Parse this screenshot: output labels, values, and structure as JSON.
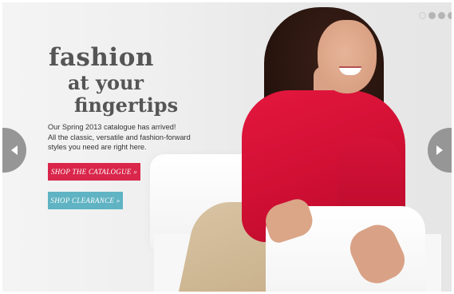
{
  "hero": {
    "headline": {
      "line1": "fashion",
      "line2": "at your",
      "line3": "fingertips"
    },
    "intro_lines": [
      "Our Spring 2013 catalogue has arrived!",
      "All the classic, versatile and fashion-forward",
      "styles you need are right here."
    ],
    "buttons": {
      "catalogue": "SHOP THE CATALOGUE »",
      "clearance": "SHOP CLEARANCE »"
    }
  },
  "carousel": {
    "slide_count": 4,
    "active_slide": 1,
    "prev_icon": "chevron-left-icon",
    "next_icon": "chevron-right-icon"
  },
  "colors": {
    "headline": "#555555",
    "catalogue_button": "#d9264a",
    "clearance_button": "#5fb3c2",
    "arrow": "#969696",
    "dot_active": "#e3e3e3",
    "dot_inactive": "#b5b5b5"
  }
}
